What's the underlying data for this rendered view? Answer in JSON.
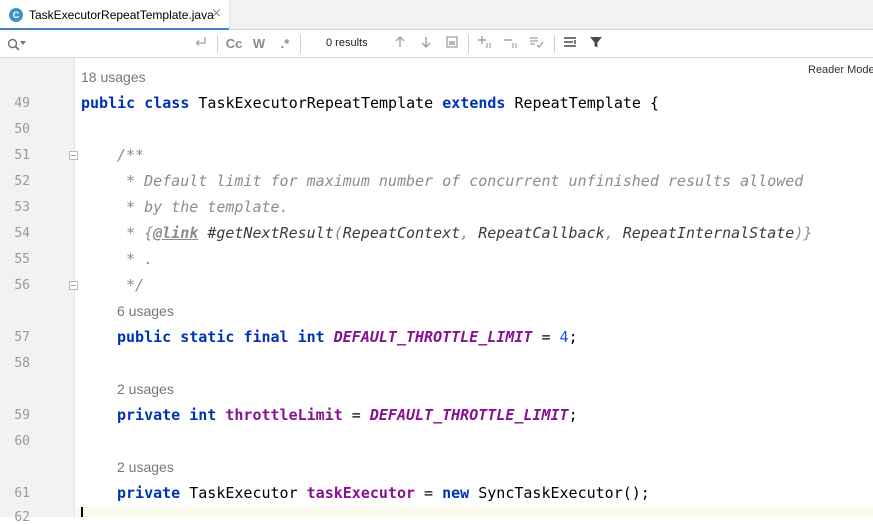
{
  "tab": {
    "icon_letter": "C",
    "title": "TaskExecutorRepeatTemplate.java",
    "close": "×"
  },
  "search": {
    "placeholder": "",
    "toolbar": {
      "match_case": "Cc",
      "words": "W",
      "regex": ".*"
    },
    "results": "0 results"
  },
  "editor": {
    "reader_mode": "Reader Mode",
    "usages": {
      "class": "18 usages",
      "throttle_const": "6 usages",
      "throttle_field": "2 usages",
      "executor_field": "2 usages"
    },
    "line_numbers": {
      "l49": "49",
      "l50": "50",
      "l51": "51",
      "l52": "52",
      "l53": "53",
      "l54": "54",
      "l55": "55",
      "l56": "56",
      "l57": "57",
      "l58": "58",
      "l59": "59",
      "l60": "60",
      "l61": "61",
      "l62": "62"
    },
    "code": {
      "kw_public": "public",
      "kw_class": "class",
      "class_name": "TaskExecutorRepeatTemplate",
      "kw_extends": "extends",
      "super_name": "RepeatTemplate",
      "brace": "{",
      "c51": "/**",
      "c52": " * Default limit for maximum number of concurrent unfinished results allowed",
      "c53": " * by the template.",
      "c54_star": " * {",
      "c54_tag": "@link",
      "c54_sp": " ",
      "c54_ref_hash": "#",
      "c54_ref_method": "getNextResult",
      "c54_paren_open": "(",
      "c54_arg1": "RepeatContext",
      "c54_comma1": ", ",
      "c54_arg2": "RepeatCallback",
      "c54_comma2": ", ",
      "c54_arg3": "RepeatInternalState",
      "c54_paren_close": ")",
      "c54_close": "}",
      "c55": " * .",
      "c56": " */",
      "kw_static": "static",
      "kw_final": "final",
      "kw_int": "int",
      "const_name": "DEFAULT_THROTTLE_LIMIT",
      "eq": " = ",
      "value_4": "4",
      "semi": ";",
      "kw_private": "private",
      "field_throttle": "throttleLimit",
      "type_executor": "TaskExecutor",
      "field_executor": "taskExecutor",
      "kw_new": "new",
      "ctor": "SyncTaskExecutor();"
    }
  }
}
